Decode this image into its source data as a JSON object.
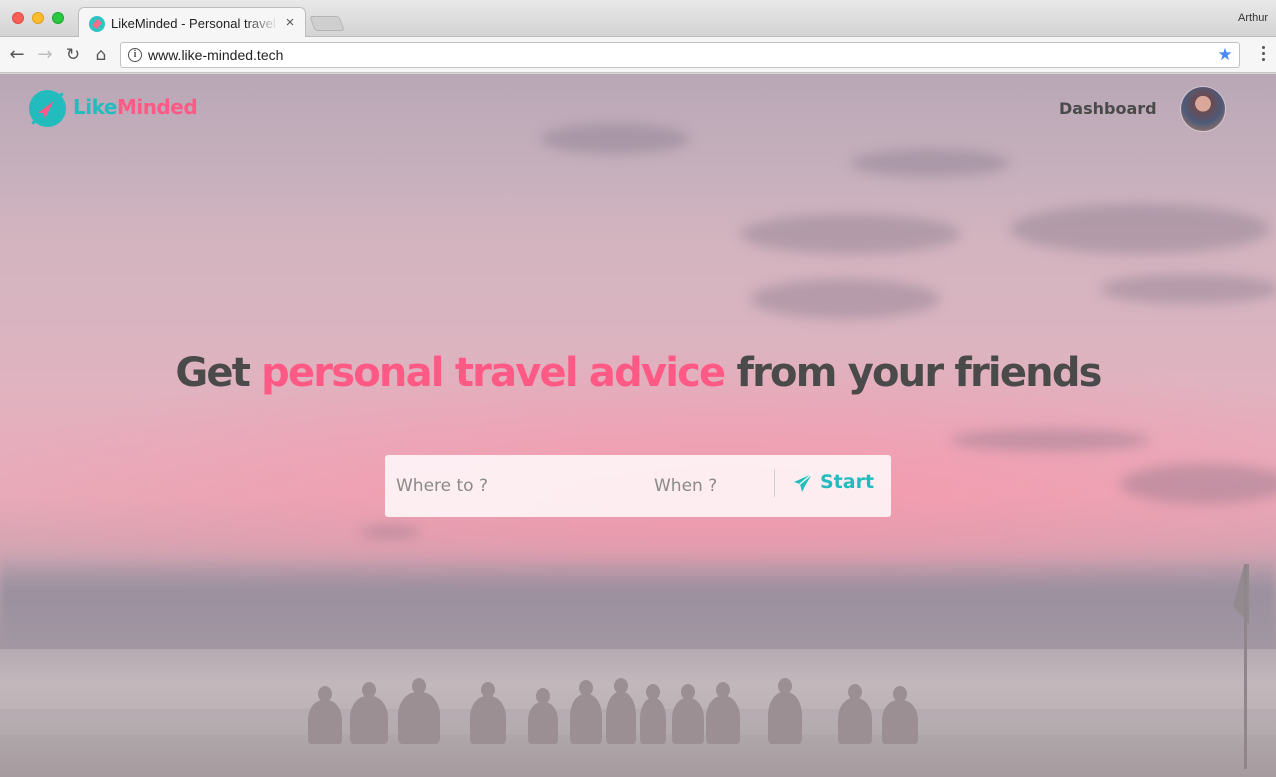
{
  "browser": {
    "tab_title": "LikeMinded - Personal travel advice",
    "tab_close": "×",
    "profile_name": "Arthur",
    "url": "www.like-minded.tech",
    "info_glyph": "i",
    "back_glyph": "←",
    "forward_glyph": "→",
    "reload_glyph": "↻",
    "home_glyph": "⌂",
    "star_glyph": "★"
  },
  "site": {
    "logo": {
      "part1": "Like",
      "part2": "Minded"
    },
    "nav": {
      "dashboard": "Dashboard"
    }
  },
  "hero": {
    "title_start": "Get ",
    "title_accent": "personal travel advice",
    "title_end": " from your friends"
  },
  "search": {
    "where_placeholder": "Where to ?",
    "when_placeholder": "When ?",
    "start_label": "Start"
  },
  "colors": {
    "brand_teal": "#23bcbe",
    "brand_pink": "#ff5a85",
    "text_dark": "#4a4a4a"
  },
  "icons": [
    "info-icon",
    "bookmark-star-icon",
    "menu-icon",
    "send-icon",
    "compass-logo-icon"
  ]
}
